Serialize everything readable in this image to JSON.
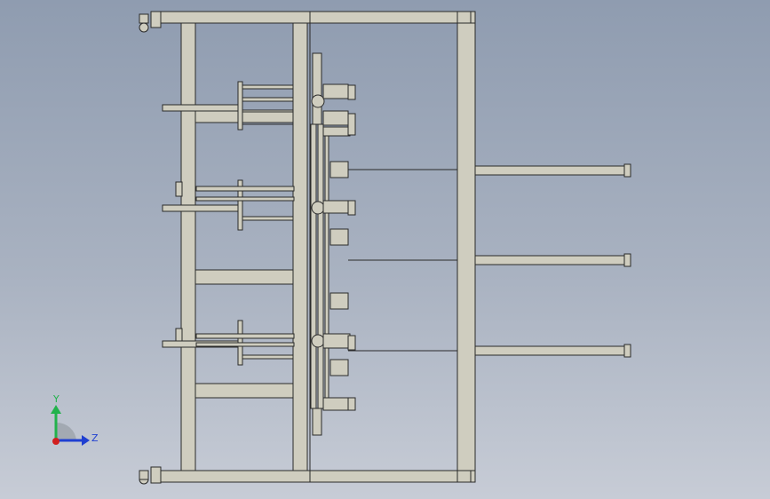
{
  "viewport": {
    "background_top": "#8f9cb0",
    "background_bottom": "#c7ccd6",
    "frame_color": "#cfcdbf",
    "edge_color": "#2a2a2a",
    "rod_color": "#d6d4c8"
  },
  "triad": {
    "y_label": "Y",
    "z_label": "Z",
    "y_color": "#22b24c",
    "z_color": "#1f3fd1",
    "x_color": "#d11f1f"
  }
}
